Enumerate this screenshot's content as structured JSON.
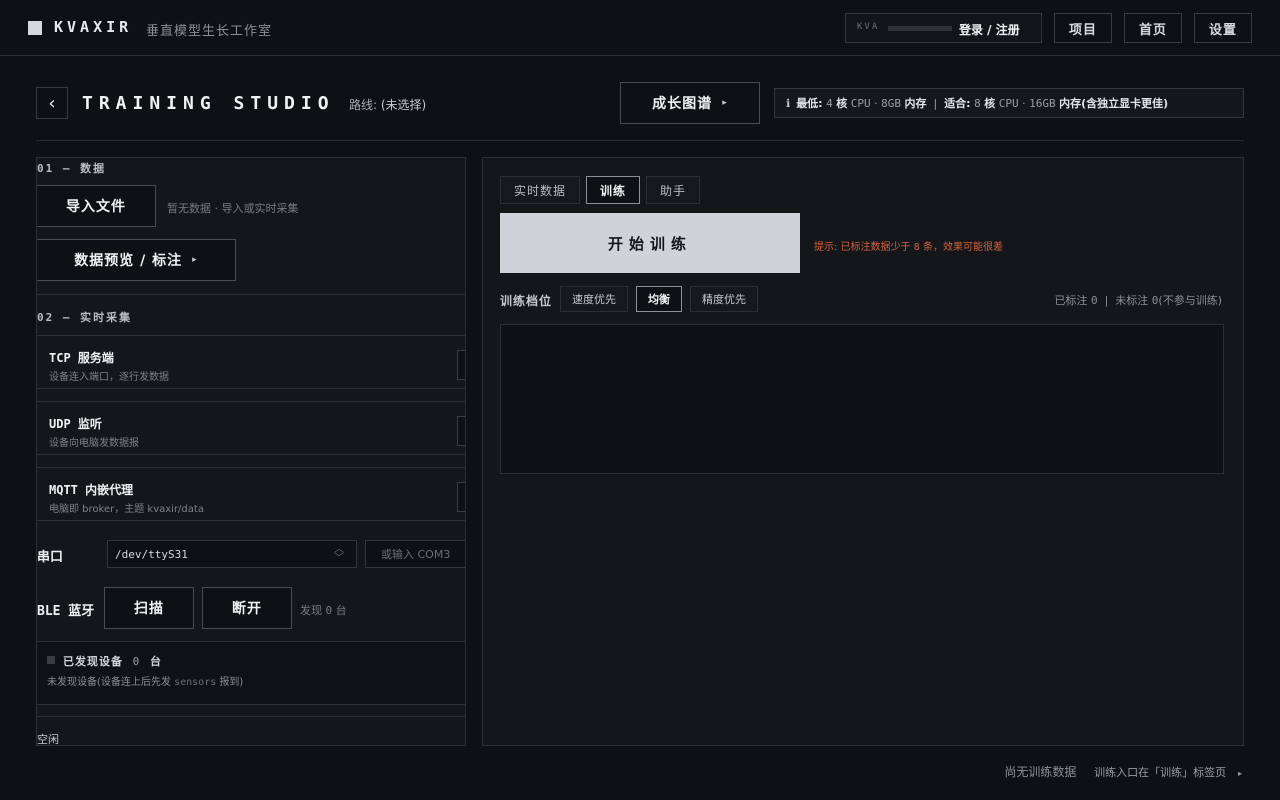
{
  "topbar": {
    "brand": "KVAXIR",
    "subtitle": "垂直模型生长工作室",
    "kva_label": "KVA",
    "login_label": "登录 / 注册",
    "nav": [
      {
        "label": "项目"
      },
      {
        "label": "首页"
      },
      {
        "label": "设置"
      }
    ]
  },
  "header": {
    "back_glyph": "‹",
    "title": "TRAINING STUDIO",
    "route_label": "路线:",
    "route_value": "(未选择)",
    "growth_button": "成长图谱",
    "growth_arrow": "▸",
    "requirements": {
      "info_icon": "ℹ",
      "min_label": "最低:",
      "min_cores": "4",
      "min_cores_unit": "核",
      "min_cpu": "CPU",
      "min_sep": "·",
      "min_mem": "8GB",
      "min_mem_unit": "内存",
      "divider": "|",
      "fit_label": "适合:",
      "fit_cores": "8",
      "fit_cores_unit": "核",
      "fit_cpu": "CPU",
      "fit_sep": "·",
      "fit_mem": "16GB",
      "fit_mem_unit": "内存(含独立显卡更佳)"
    }
  },
  "left": {
    "section1_title": "01 — 数据",
    "import_button": "导入文件",
    "no_data_text": "暂无数据 · 导入或实时采集",
    "preview_button": "数据预览 / 标注",
    "preview_arrow": "▸",
    "section2_title": "02 — 实时采集",
    "protocols": [
      {
        "title": "TCP 服务端",
        "desc": "设备连入端口，逐行发数据"
      },
      {
        "title": "UDP 监听",
        "desc": "设备向电脑发数据报"
      },
      {
        "title": "MQTT 内嵌代理",
        "desc": "电脑即 broker，主题 kvaxir/data"
      }
    ],
    "serial": {
      "label": "串口",
      "selected": "/dev/ttyS31",
      "input_placeholder": "或输入 COM3"
    },
    "ble": {
      "label": "BLE 蓝牙",
      "scan_button": "扫描",
      "disconnect_button": "断开",
      "found_prefix": "发现",
      "found_count": "0",
      "found_suffix": "台"
    },
    "devices": {
      "title_prefix": "已发现设备",
      "count": "0",
      "title_suffix": "台",
      "desc_prefix": "未发现设备(设备连上后先发",
      "desc_code": "sensors",
      "desc_suffix": "报到)"
    },
    "status": "空闲"
  },
  "right": {
    "tabs": [
      {
        "label": "实时数据",
        "active": false
      },
      {
        "label": "训练",
        "active": true
      },
      {
        "label": "助手",
        "active": false
      }
    ],
    "start_button": "开始训练",
    "warning_prefix": "提示: 已标注数据少于",
    "warning_num": "8",
    "warning_suffix": "条，效果可能很差",
    "gear_label": "训练档位",
    "modes": [
      {
        "label": "速度优先",
        "active": false
      },
      {
        "label": "均衡",
        "active": true
      },
      {
        "label": "精度优先",
        "active": false
      }
    ],
    "labeled_label": "已标注",
    "labeled_count": "0",
    "counts_sep": "|",
    "unlabeled_label": "未标注",
    "unlabeled_count": "0",
    "unlabeled_note": "(不参与训练)"
  },
  "footer": {
    "no_data": "尚无训练数据",
    "hint": "训练入口在「训练」标签页",
    "arrow": "▸"
  },
  "colors": {
    "background": "#0f1013",
    "panel": "#15161a",
    "primary_button": "#cfd2d9",
    "warning": "#d2633f"
  }
}
